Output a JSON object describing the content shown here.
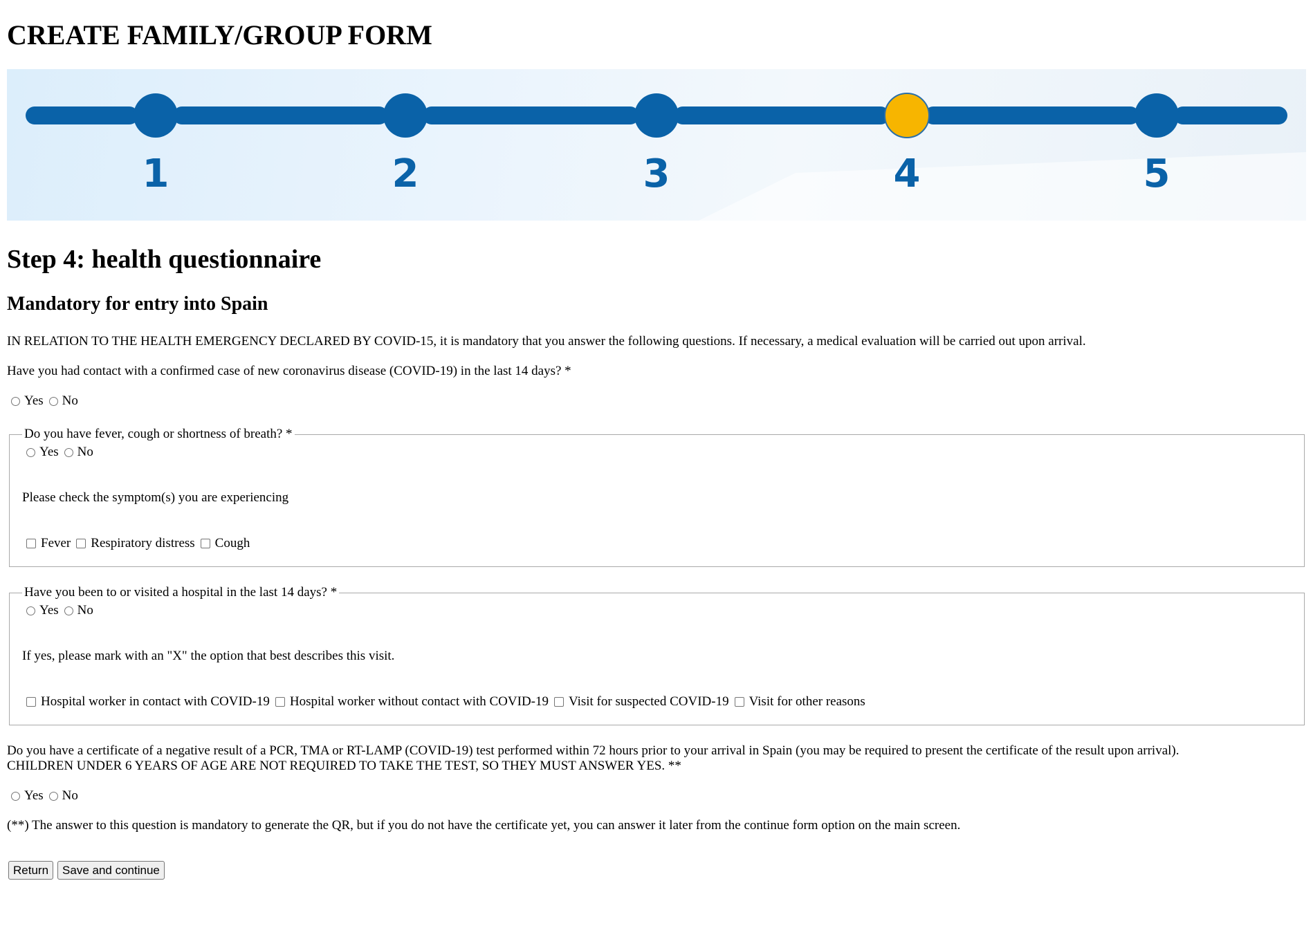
{
  "page": {
    "title": "CREATE FAMILY/GROUP FORM",
    "step_heading": "Step 4: health questionnaire",
    "subheading": "Mandatory for entry into Spain",
    "intro": "IN RELATION TO THE HEALTH EMERGENCY DECLARED BY COVID-15, it is mandatory that you answer the following questions. If necessary, a medical evaluation will be carried out upon arrival."
  },
  "progress": {
    "steps": [
      "1",
      "2",
      "3",
      "4",
      "5"
    ],
    "current_step": 4,
    "colors": {
      "track": "#0a62a8",
      "current": "#f7b500",
      "label": "#0a62a8"
    }
  },
  "q_contact": {
    "question": "Have you had contact with a confirmed case of new coronavirus disease (COVID-19) in the last 14 days? *",
    "yes": "Yes",
    "no": "No"
  },
  "q_symptoms": {
    "legend": "Do you have fever, cough or shortness of breath? *",
    "yes": "Yes",
    "no": "No",
    "instruction": "Please check the symptom(s) you are experiencing",
    "options": [
      "Fever",
      "Respiratory distress",
      "Cough"
    ]
  },
  "q_hospital": {
    "legend": "Have you been to or visited a hospital in the last 14 days? *",
    "yes": "Yes",
    "no": "No",
    "instruction": "If yes, please mark with an \"X\" the option that best describes this visit.",
    "options": [
      "Hospital worker in contact with COVID-19",
      "Hospital worker without contact with COVID-19",
      "Visit for suspected COVID-19",
      "Visit for other reasons"
    ]
  },
  "q_certificate": {
    "line1": "Do you have a certificate of a negative result of a PCR, TMA or RT-LAMP (COVID-19) test performed within 72 hours prior to your arrival in Spain (you may be required to present the certificate of the result upon arrival).",
    "line2": "CHILDREN UNDER 6 YEARS OF AGE ARE NOT REQUIRED TO TAKE THE TEST, SO THEY MUST ANSWER YES. **",
    "yes": "Yes",
    "no": "No"
  },
  "footnote": "(**) The answer to this question is mandatory to generate the QR, but if you do not have the certificate yet, you can answer it later from the continue form option on the main screen.",
  "buttons": {
    "return": "Return",
    "save": "Save and continue"
  }
}
